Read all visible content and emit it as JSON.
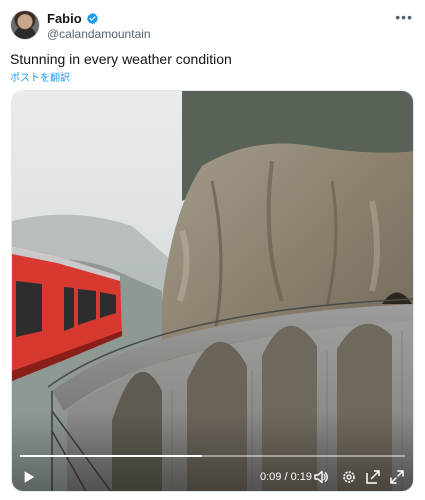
{
  "author": {
    "display_name": "Fabio",
    "handle": "@calandamountain",
    "verified_icon": "verified-badge-icon"
  },
  "tweet": {
    "text": "Stunning in every weather condition",
    "translate_label": "ポストを翻訳"
  },
  "video": {
    "current_time": "0:09",
    "duration": "0:19",
    "time_separator": " / ",
    "progress_fraction": 0.474,
    "controls": [
      "play-icon",
      "volume-icon",
      "settings-icon",
      "picture-in-picture-icon",
      "fullscreen-icon"
    ]
  },
  "colors": {
    "accent": "#1d9bf0",
    "train_red": "#d7382f",
    "handle_gray": "#536471"
  }
}
